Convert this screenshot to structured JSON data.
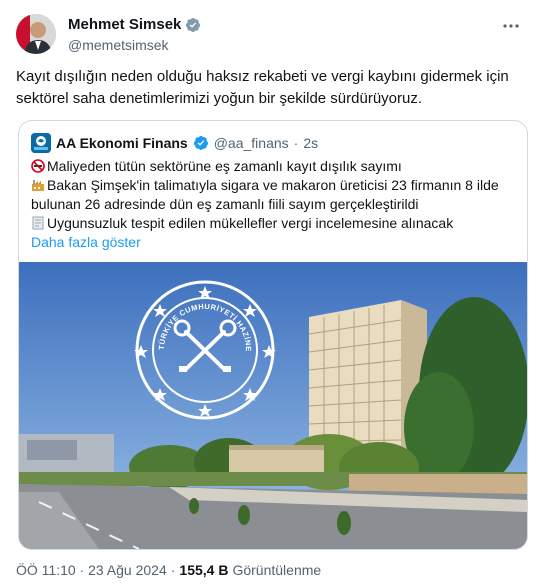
{
  "author": {
    "name": "Mehmet Simsek",
    "handle": "@memetsimsek"
  },
  "tweet": {
    "text": "Kayıt dışılığın neden olduğu haksız rekabeti ve vergi kaybını gidermek için sektörel saha denetimlerimizi yoğun bir şekilde sürdürüyoruz."
  },
  "quoted": {
    "name": "AA Ekonomi Finans",
    "handle": "@aa_finans",
    "separator": "·",
    "time": "2s",
    "lines": [
      "Maliyeden tütün sektörüne eş zamanlı kayıt dışılık sayımı",
      "Bakan Şimşek'in talimatıyla sigara ve makaron üreticisi 23 firmanın 8 ilde bulunan 26 adresinde dün eş zamanlı fiili sayım gerçekleştirildi",
      "Uygunsuzluk tespit edilen mükellefler vergi incelemesine alınacak"
    ],
    "show_more": "Daha fazla göster",
    "image": {
      "seal_text": "TÜRKİYE CUMHURİYETİ HAZİNE VE MALİYE BAKANLIĞI"
    }
  },
  "footer": {
    "time": "ÖÖ 11:10 · 23 Ağu 2024",
    "separator": "·",
    "views_count": "155,4 B",
    "views_label": "Görüntülenme"
  },
  "colors": {
    "link": "#1d9bf0",
    "verified": "#829aab",
    "secondary_text": "#536471"
  }
}
